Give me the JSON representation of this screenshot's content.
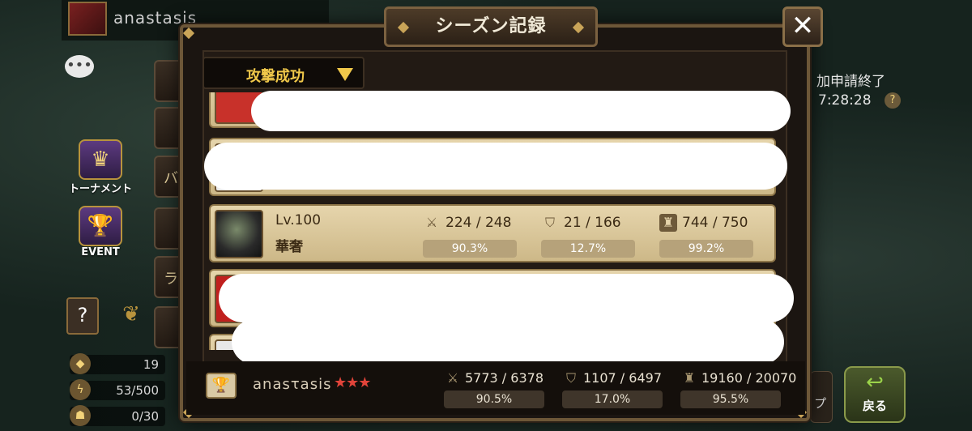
{
  "background": {
    "player_name": "anastasis",
    "chat_icon": "chat-bubble-icon",
    "left_menu": [
      {
        "label": "トーナメント",
        "icon": "tournament-icon"
      },
      {
        "label": "EVENT",
        "icon": "trophy-event-icon"
      }
    ],
    "side_stubs": [
      "",
      "",
      "バ",
      "",
      "ラ",
      ""
    ],
    "resources": [
      {
        "icon": "crystal-icon",
        "value": "19"
      },
      {
        "icon": "energy-icon",
        "value": "53/500"
      },
      {
        "icon": "arena-wing-icon",
        "value": "0/30"
      }
    ],
    "right_info": "加申請終了",
    "right_time": "7:28:28",
    "right_help": "?",
    "right_stub_label": "プ",
    "back_button_label": "戻る"
  },
  "dialog": {
    "title": "シーズン記録",
    "close_label": "✕",
    "filter_label": "攻撃成功",
    "visible_monster": {
      "level": "Lv.100",
      "name": "華奢",
      "attack": {
        "icon": "crossed-swords-icon",
        "value": "224 / 248",
        "percent": "90.3%"
      },
      "defense": {
        "icon": "shield-icon",
        "value": "21 / 166",
        "percent": "12.7%"
      },
      "tower": {
        "icon": "tower-icon",
        "value": "744 / 750",
        "percent": "99.2%"
      }
    },
    "footer": {
      "player_name": "anasτasis",
      "stars": "★★★",
      "attack": {
        "icon": "crossed-swords-icon",
        "value": "5773 / 6378",
        "percent": "90.5%"
      },
      "defense": {
        "icon": "shield-icon",
        "value": "1107 / 6497",
        "percent": "17.0%"
      },
      "tower": {
        "icon": "tower-icon",
        "value": "19160 / 20070",
        "percent": "95.5%"
      }
    },
    "colors": {
      "panel_row": "#e6d5ac",
      "accent_gold": "#f0c84a",
      "star_red": "#e2443a"
    }
  }
}
